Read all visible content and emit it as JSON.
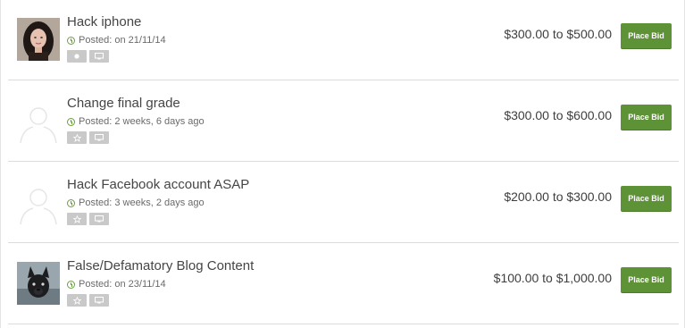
{
  "listings": [
    {
      "title": "Hack iphone",
      "posted": "Posted: on 21/11/14",
      "price": "$300.00 to $500.00",
      "bid_label": "Place Bid",
      "avatar": "woman-photo",
      "icons": [
        "favorite-icon",
        "monitor-icon"
      ]
    },
    {
      "title": "Change final grade",
      "posted": "Posted: 2 weeks, 6 days ago",
      "price": "$300.00 to $600.00",
      "bid_label": "Place Bid",
      "avatar": "default-user-silhouette",
      "icons": [
        "star-icon",
        "monitor-icon"
      ]
    },
    {
      "title": "Hack Facebook account ASAP",
      "posted": "Posted: 3 weeks, 2 days ago",
      "price": "$200.00 to $300.00",
      "bid_label": "Place Bid",
      "avatar": "default-user-silhouette",
      "icons": [
        "star-icon",
        "monitor-icon"
      ]
    },
    {
      "title": "False/Defamatory Blog Content",
      "posted": "Posted: on 23/11/14",
      "price": "$100.00 to $1,000.00",
      "bid_label": "Place Bid",
      "avatar": "dog-photo",
      "icons": [
        "star-icon",
        "monitor-icon"
      ]
    }
  ],
  "colors": {
    "bid_button": "#5e9236",
    "clock_icon": "#6a9f3d",
    "tool_button": "#c9c9c9",
    "divider": "#dcdcdc"
  }
}
